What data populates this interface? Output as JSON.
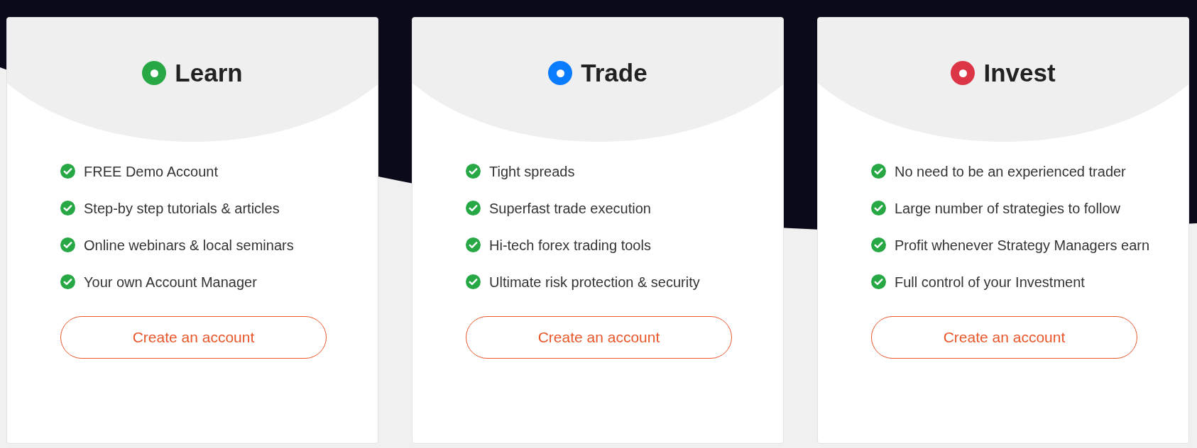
{
  "plans": [
    {
      "title": "Learn",
      "color": "#28a745",
      "features": [
        "FREE Demo Account",
        "Step-by step tutorials & articles",
        "Online webinars & local seminars",
        "Your own Account Manager"
      ],
      "button": "Create an account"
    },
    {
      "title": "Trade",
      "color": "#0a7cff",
      "features": [
        "Tight spreads",
        "Superfast trade execution",
        "Hi-tech forex trading tools",
        "Ultimate risk protection & security"
      ],
      "button": "Create an account"
    },
    {
      "title": "Invest",
      "color": "#dc3545",
      "features": [
        "No need to be an experienced trader",
        "Large number of strategies to follow",
        "Profit whenever Strategy Managers earn",
        "Full control of your Investment"
      ],
      "button": "Create an account"
    }
  ]
}
